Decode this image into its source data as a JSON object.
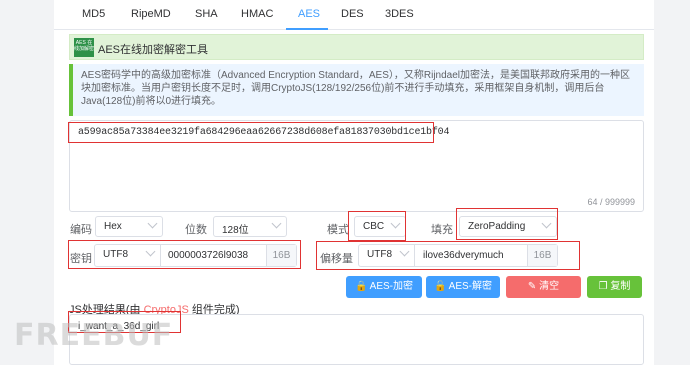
{
  "tabs": [
    {
      "label": "MD5"
    },
    {
      "label": "RipeMD"
    },
    {
      "label": "SHA"
    },
    {
      "label": "HMAC"
    },
    {
      "label": "AES",
      "active": true
    },
    {
      "label": "DES"
    },
    {
      "label": "3DES"
    }
  ],
  "header": {
    "logo_text": "AES 在线加解密",
    "title": "AES在线加密解密工具"
  },
  "description": "AES密码学中的高级加密标准（Advanced Encryption Standard，AES），又称Rijndael加密法，是美国联邦政府采用的一种区块加密标准。当用户密钥长度不足时，调用CryptoJS(128/192/256位)前不进行手动填充，采用框架自身机制，调用后台Java(128位)前将以0进行填充。",
  "input": {
    "value": "a599ac85a73384ee3219fa684296eaa62667238d608efa81837030bd1ce1bf04",
    "counter": "64 / 999999"
  },
  "options": {
    "encoding_label": "编码",
    "encoding_value": "Hex",
    "bits_label": "位数",
    "bits_value": "128位",
    "mode_label": "模式",
    "mode_value": "CBC",
    "padding_label": "填充",
    "padding_value": "ZeroPadding"
  },
  "key": {
    "label": "密钥",
    "encoding": "UTF8",
    "value": "0000003726l9038",
    "suffix": "16B"
  },
  "iv": {
    "label": "偏移量",
    "encoding": "UTF8",
    "value": "ilove36dverymuch",
    "suffix": "16B"
  },
  "buttons": {
    "encrypt": "AES-加密",
    "decrypt": "AES-解密",
    "clear": "清空",
    "copy": "复制"
  },
  "result": {
    "label_prefix": "JS处理结果(由 ",
    "label_link": "CryptoJS",
    "label_suffix": " 组件完成)",
    "value": "i_want_a_36d_girl"
  },
  "watermark": "FREEBUF",
  "colors": {
    "accent": "#409eff",
    "highlight": "#e03333",
    "success": "#67c23a",
    "danger": "#f56c6c"
  }
}
